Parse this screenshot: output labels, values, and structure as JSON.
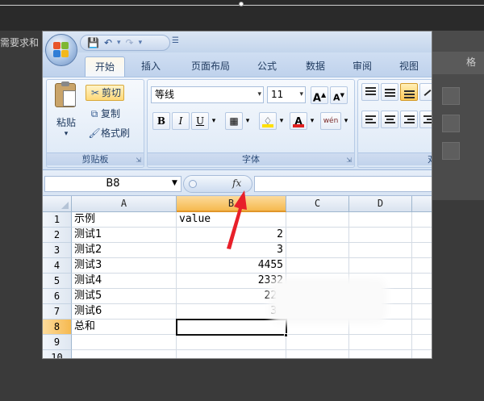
{
  "background": {
    "left_text": "需要求和",
    "right_text": "格"
  },
  "office_button": {
    "icon": "office-logo-icon"
  },
  "quick_access": {
    "save_icon": "save-icon",
    "undo_icon": "undo-icon",
    "redo_icon": "redo-icon"
  },
  "tabs": [
    {
      "label": "开始",
      "active": true
    },
    {
      "label": "插入",
      "active": false
    },
    {
      "label": "页面布局",
      "active": false
    },
    {
      "label": "公式",
      "active": false
    },
    {
      "label": "数据",
      "active": false
    },
    {
      "label": "审阅",
      "active": false
    },
    {
      "label": "视图",
      "active": false
    }
  ],
  "clipboard": {
    "paste_label": "粘贴",
    "cut_label": "剪切",
    "copy_label": "复制",
    "format_painter_label": "格式刷",
    "group_label": "剪贴板"
  },
  "font": {
    "font_name": "等线",
    "font_size": "11",
    "grow_label": "A",
    "shrink_label": "A",
    "bold_label": "B",
    "italic_label": "I",
    "underline_label": "U",
    "font_color_label": "A",
    "phonetic_label": "wén",
    "group_label": "字体",
    "colors": {
      "font_color": "#e02020",
      "highlight": "#ffe000"
    }
  },
  "alignment": {
    "group_label_partial": "对"
  },
  "formula_bar": {
    "name_box": "B8",
    "fx_label": "fx",
    "formula": ""
  },
  "grid": {
    "columns": [
      "A",
      "B",
      "C",
      "D"
    ],
    "selected_column": "B",
    "selected_row": "8",
    "rows": [
      {
        "num": "1",
        "a": "示例",
        "b": "value"
      },
      {
        "num": "2",
        "a": "测试1",
        "b": "2"
      },
      {
        "num": "3",
        "a": "测试2",
        "b": "3"
      },
      {
        "num": "4",
        "a": "测试3",
        "b": "4455"
      },
      {
        "num": "5",
        "a": "测试4",
        "b": "2332"
      },
      {
        "num": "6",
        "a": "测试5",
        "b": "223"
      },
      {
        "num": "7",
        "a": "测试6",
        "b": "34"
      },
      {
        "num": "8",
        "a": "总和",
        "b": ""
      },
      {
        "num": "9",
        "a": "",
        "b": ""
      },
      {
        "num": "10",
        "a": "",
        "b": ""
      }
    ]
  },
  "annotation": {
    "arrow_color": "#e8202a"
  }
}
